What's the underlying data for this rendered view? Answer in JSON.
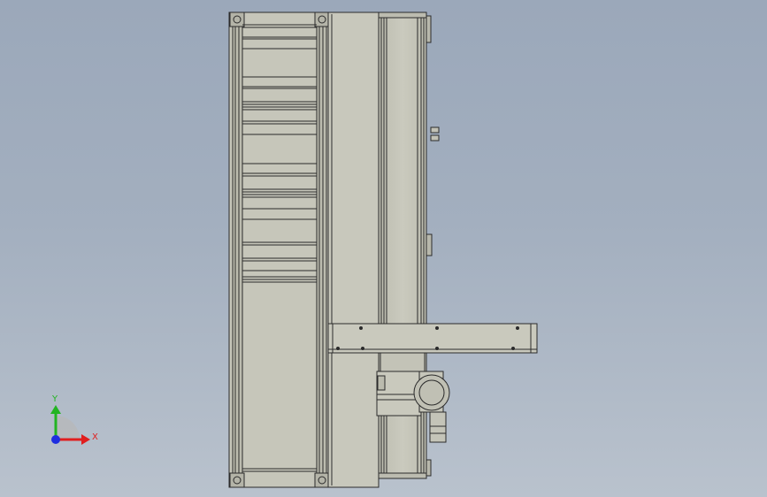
{
  "colors": {
    "background_top": "#9ba8ba",
    "background_bottom": "#b9c2cd",
    "body_fill": "#c6c6ba",
    "outline": "#2b2b2b",
    "axis_x": "#e01e1e",
    "axis_y": "#22b422",
    "axis_z": "#1e2ee0"
  },
  "triad": {
    "x_label": "X",
    "y_label": "Y"
  }
}
